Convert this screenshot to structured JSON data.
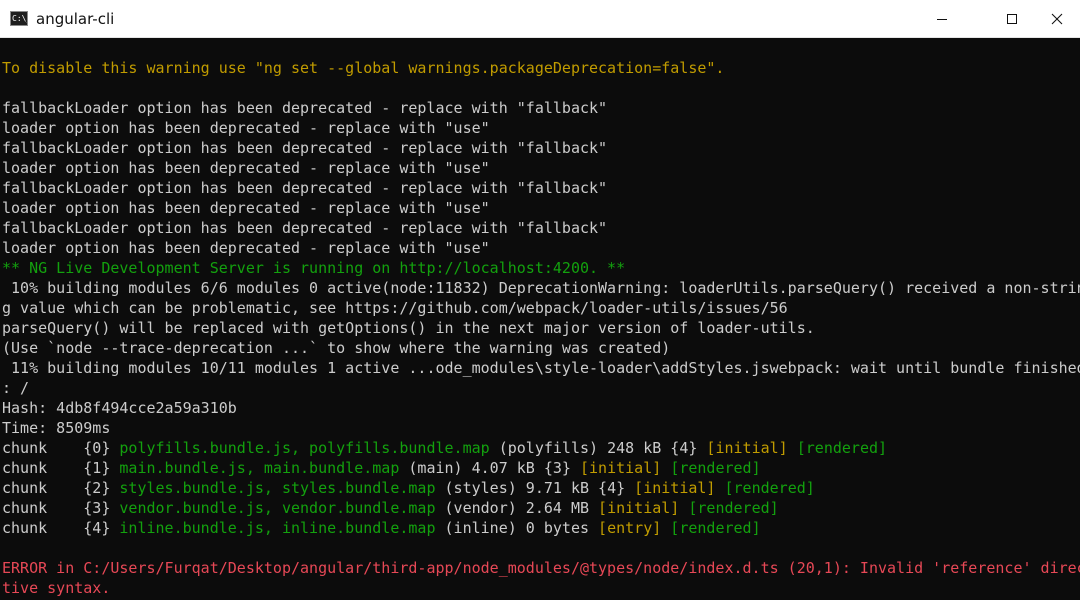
{
  "window": {
    "title": "angular-cli",
    "app_icon_text": "C:\\_"
  },
  "console": {
    "lines": [
      {
        "segments": [
          {
            "text": "To disable this warning use \"ng set --global warnings.packageDeprecation=false\".",
            "color": "#c19c00"
          }
        ]
      },
      {
        "segments": []
      },
      {
        "segments": [
          {
            "text": "fallbackLoader option has been deprecated - replace with \"fallback\"",
            "color": "#cccccc"
          }
        ]
      },
      {
        "segments": [
          {
            "text": "loader option has been deprecated - replace with \"use\"",
            "color": "#cccccc"
          }
        ]
      },
      {
        "segments": [
          {
            "text": "fallbackLoader option has been deprecated - replace with \"fallback\"",
            "color": "#cccccc"
          }
        ]
      },
      {
        "segments": [
          {
            "text": "loader option has been deprecated - replace with \"use\"",
            "color": "#cccccc"
          }
        ]
      },
      {
        "segments": [
          {
            "text": "fallbackLoader option has been deprecated - replace with \"fallback\"",
            "color": "#cccccc"
          }
        ]
      },
      {
        "segments": [
          {
            "text": "loader option has been deprecated - replace with \"use\"",
            "color": "#cccccc"
          }
        ]
      },
      {
        "segments": [
          {
            "text": "fallbackLoader option has been deprecated - replace with \"fallback\"",
            "color": "#cccccc"
          }
        ]
      },
      {
        "segments": [
          {
            "text": "loader option has been deprecated - replace with \"use\"",
            "color": "#cccccc"
          }
        ]
      },
      {
        "segments": [
          {
            "text": "** NG Live Development Server is running on http://localhost:4200. **",
            "color": "#13a10e"
          }
        ]
      },
      {
        "segments": [
          {
            "text": " 10% building modules 6/6 modules 0 active(node:11832) DeprecationWarning: loaderUtils.parseQuery() received a non-strin",
            "color": "#cccccc"
          }
        ]
      },
      {
        "segments": [
          {
            "text": "g value which can be problematic, see https://github.com/webpack/loader-utils/issues/56",
            "color": "#cccccc"
          }
        ]
      },
      {
        "segments": [
          {
            "text": "parseQuery() will be replaced with getOptions() in the next major version of loader-utils.",
            "color": "#cccccc"
          }
        ]
      },
      {
        "segments": [
          {
            "text": "(Use `node --trace-deprecation ...` to show where the warning was created)",
            "color": "#cccccc"
          }
        ]
      },
      {
        "segments": [
          {
            "text": " 11% building modules 10/11 modules 1 active ...ode_modules\\style-loader\\addStyles.jswebpack: wait until bundle finished",
            "color": "#cccccc"
          }
        ]
      },
      {
        "segments": [
          {
            "text": ": /",
            "color": "#cccccc"
          }
        ]
      },
      {
        "segments": [
          {
            "text": "Hash: 4db8f494cce2a59a310b",
            "color": "#cccccc"
          }
        ]
      },
      {
        "segments": [
          {
            "text": "Time: 8509ms",
            "color": "#cccccc"
          }
        ]
      },
      {
        "segments": [
          {
            "text": "chunk    {0} ",
            "color": "#cccccc"
          },
          {
            "text": "polyfills.bundle.js, polyfills.bundle.map",
            "color": "#13a10e"
          },
          {
            "text": " (polyfills) 248 kB {4} ",
            "color": "#cccccc"
          },
          {
            "text": "[initial]",
            "color": "#c19c00"
          },
          {
            "text": " ",
            "color": "#cccccc"
          },
          {
            "text": "[rendered]",
            "color": "#13a10e"
          }
        ]
      },
      {
        "segments": [
          {
            "text": "chunk    {1} ",
            "color": "#cccccc"
          },
          {
            "text": "main.bundle.js, main.bundle.map",
            "color": "#13a10e"
          },
          {
            "text": " (main) 4.07 kB {3} ",
            "color": "#cccccc"
          },
          {
            "text": "[initial]",
            "color": "#c19c00"
          },
          {
            "text": " ",
            "color": "#cccccc"
          },
          {
            "text": "[rendered]",
            "color": "#13a10e"
          }
        ]
      },
      {
        "segments": [
          {
            "text": "chunk    {2} ",
            "color": "#cccccc"
          },
          {
            "text": "styles.bundle.js, styles.bundle.map",
            "color": "#13a10e"
          },
          {
            "text": " (styles) 9.71 kB {4} ",
            "color": "#cccccc"
          },
          {
            "text": "[initial]",
            "color": "#c19c00"
          },
          {
            "text": " ",
            "color": "#cccccc"
          },
          {
            "text": "[rendered]",
            "color": "#13a10e"
          }
        ]
      },
      {
        "segments": [
          {
            "text": "chunk    {3} ",
            "color": "#cccccc"
          },
          {
            "text": "vendor.bundle.js, vendor.bundle.map",
            "color": "#13a10e"
          },
          {
            "text": " (vendor) 2.64 MB ",
            "color": "#cccccc"
          },
          {
            "text": "[initial]",
            "color": "#c19c00"
          },
          {
            "text": " ",
            "color": "#cccccc"
          },
          {
            "text": "[rendered]",
            "color": "#13a10e"
          }
        ]
      },
      {
        "segments": [
          {
            "text": "chunk    {4} ",
            "color": "#cccccc"
          },
          {
            "text": "inline.bundle.js, inline.bundle.map",
            "color": "#13a10e"
          },
          {
            "text": " (inline) 0 bytes ",
            "color": "#cccccc"
          },
          {
            "text": "[entry]",
            "color": "#c19c00"
          },
          {
            "text": " ",
            "color": "#cccccc"
          },
          {
            "text": "[rendered]",
            "color": "#13a10e"
          }
        ]
      },
      {
        "segments": []
      },
      {
        "segments": [
          {
            "text": "ERROR in C:/Users/Furqat/Desktop/angular/third-app/node_modules/@types/node/index.d.ts (20,1): Invalid 'reference' direc",
            "color": "#e74856"
          }
        ]
      },
      {
        "segments": [
          {
            "text": "tive syntax.",
            "color": "#e74856"
          }
        ]
      }
    ]
  }
}
